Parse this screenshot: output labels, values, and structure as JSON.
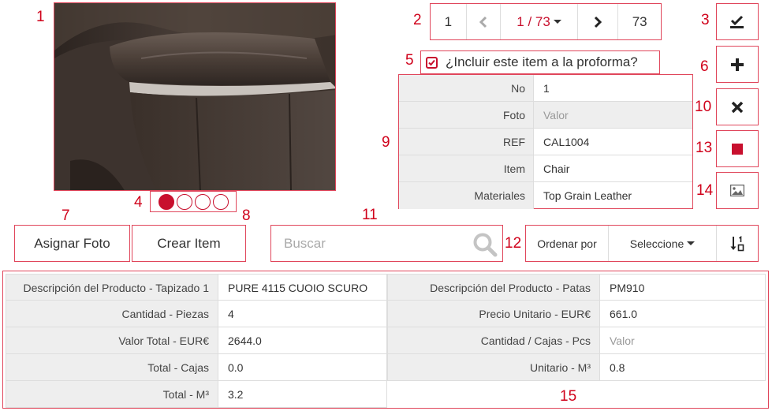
{
  "annotations": {
    "a1": "1",
    "a2": "2",
    "a3": "3",
    "a4": "4",
    "a5": "5",
    "a6": "6",
    "a7": "7",
    "a8": "8",
    "a9": "9",
    "a10": "10",
    "a11": "11",
    "a12": "12",
    "a13": "13",
    "a14": "14",
    "a15": "15"
  },
  "colors": {
    "accent": "#c8102e",
    "annotation": "#d0021b",
    "label_bg": "#eeeeee"
  },
  "carousel": {
    "count": 4,
    "active_index": 0
  },
  "pager": {
    "first": "1",
    "prev_icon": "chevron-left-icon",
    "current": "1 / 73",
    "next_icon": "chevron-right-icon",
    "last": "73"
  },
  "side_buttons": [
    "check-sign-icon",
    "plus-icon",
    "times-icon",
    "stop-square-icon",
    "image-icon"
  ],
  "include": {
    "label": "¿Incluir este item a la proforma?",
    "checked": true
  },
  "item_fields": [
    {
      "label": "No",
      "value": "1",
      "placeholder": false
    },
    {
      "label": "Foto",
      "value": "Valor",
      "placeholder": true
    },
    {
      "label": "REF",
      "value": "CAL1004",
      "placeholder": false
    },
    {
      "label": "Item",
      "value": "Chair",
      "placeholder": false
    },
    {
      "label": "Materiales",
      "value": "Top Grain Leather",
      "placeholder": false
    }
  ],
  "actions": {
    "assign_photo": "Asignar Foto",
    "create_item": "Crear Item"
  },
  "search": {
    "placeholder": "Buscar"
  },
  "sort": {
    "label": "Ordenar por",
    "select": "Seleccione"
  },
  "product_fields": [
    {
      "l1": "Descripción del Producto - Tapizado 1",
      "v1": "PURE 4115 CUOIO SCURO",
      "v1_ph": false,
      "l2": "Descripción del Producto - Patas",
      "v2": "PM910",
      "v2_ph": false
    },
    {
      "l1": "Cantidad - Piezas",
      "v1": "4",
      "v1_ph": false,
      "l2": "Precio Unitario - EUR€",
      "v2": "661.0",
      "v2_ph": false
    },
    {
      "l1": "Valor Total - EUR€",
      "v1": "2644.0",
      "v1_ph": false,
      "l2": "Cantidad / Cajas - Pcs",
      "v2": "Valor",
      "v2_ph": true
    },
    {
      "l1": "Total - Cajas",
      "v1": "0.0",
      "v1_ph": false,
      "l2": "Unitario - M³",
      "v2": "0.8",
      "v2_ph": false
    },
    {
      "l1": "Total - M³",
      "v1": "3.2",
      "v1_ph": false,
      "l2": "",
      "v2": "",
      "v2_ph": false
    }
  ]
}
